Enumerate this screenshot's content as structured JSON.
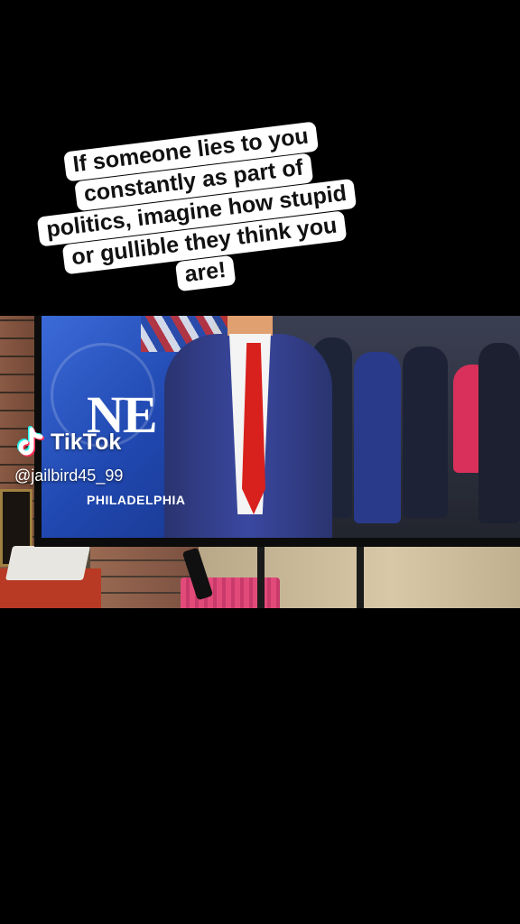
{
  "caption": {
    "lines": [
      "If someone lies to you",
      "constantly as part of",
      "politics, imagine how stupid",
      "or gullible they think you",
      "are!"
    ]
  },
  "watermark": {
    "brand": "TikTok",
    "handle": "@jailbird45_99",
    "icon": "tiktok-logo-icon"
  },
  "broadcast": {
    "dateline": "PHILADELPHIA",
    "logo_fragment": "NE"
  },
  "colors": {
    "caption_bg": "#ffffff",
    "caption_text": "#111111",
    "tiktok_cyan": "#25f4ee",
    "tiktok_red": "#fe2c55",
    "broadcast_blue": "#2a52c0"
  }
}
